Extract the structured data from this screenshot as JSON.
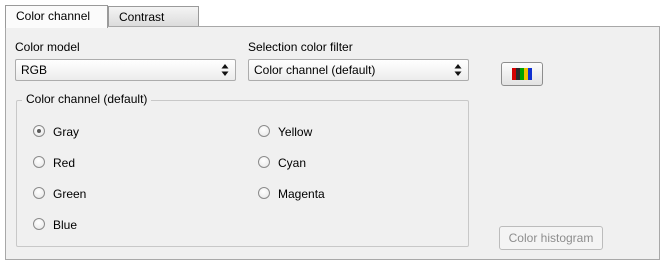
{
  "tabs": [
    {
      "label": "Color channel",
      "active": true
    },
    {
      "label": "Contrast",
      "active": false
    }
  ],
  "color_model": {
    "label": "Color model",
    "value": "RGB"
  },
  "selection_filter": {
    "label": "Selection color filter",
    "value": "Color channel (default)"
  },
  "palette_button": {
    "icon": "color-palette-icon",
    "colors": [
      "#d40000",
      "#2a2a2a",
      "#00a000",
      "#f0c000",
      "#1030d0"
    ]
  },
  "channel_group": {
    "title": "Color channel (default)",
    "options": [
      {
        "label": "Gray",
        "checked": true
      },
      {
        "label": "Red",
        "checked": false
      },
      {
        "label": "Green",
        "checked": false
      },
      {
        "label": "Blue",
        "checked": false
      },
      {
        "label": "Yellow",
        "checked": false
      },
      {
        "label": "Cyan",
        "checked": false
      },
      {
        "label": "Magenta",
        "checked": false
      }
    ]
  },
  "histogram_button": {
    "label": "Color histogram",
    "enabled": false
  }
}
